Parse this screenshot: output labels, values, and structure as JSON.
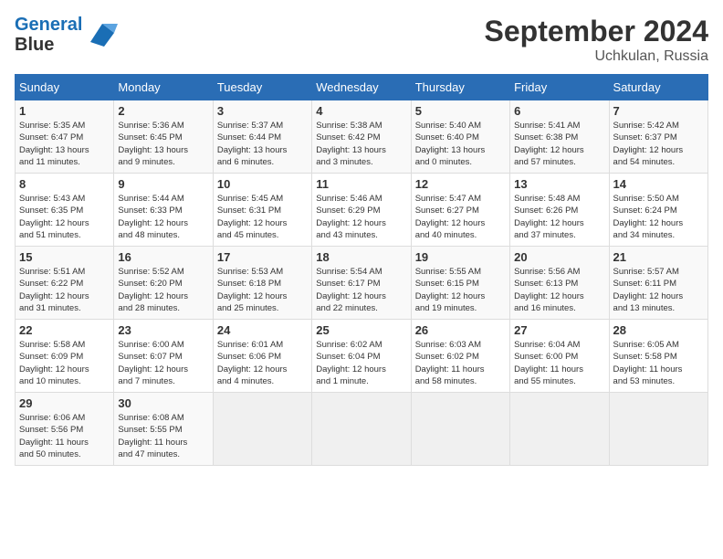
{
  "logo": {
    "line1": "General",
    "line2": "Blue"
  },
  "title": "September 2024",
  "location": "Uchkulan, Russia",
  "days_of_week": [
    "Sunday",
    "Monday",
    "Tuesday",
    "Wednesday",
    "Thursday",
    "Friday",
    "Saturday"
  ],
  "weeks": [
    [
      {
        "day": "1",
        "detail": "Sunrise: 5:35 AM\nSunset: 6:47 PM\nDaylight: 13 hours\nand 11 minutes."
      },
      {
        "day": "2",
        "detail": "Sunrise: 5:36 AM\nSunset: 6:45 PM\nDaylight: 13 hours\nand 9 minutes."
      },
      {
        "day": "3",
        "detail": "Sunrise: 5:37 AM\nSunset: 6:44 PM\nDaylight: 13 hours\nand 6 minutes."
      },
      {
        "day": "4",
        "detail": "Sunrise: 5:38 AM\nSunset: 6:42 PM\nDaylight: 13 hours\nand 3 minutes."
      },
      {
        "day": "5",
        "detail": "Sunrise: 5:40 AM\nSunset: 6:40 PM\nDaylight: 13 hours\nand 0 minutes."
      },
      {
        "day": "6",
        "detail": "Sunrise: 5:41 AM\nSunset: 6:38 PM\nDaylight: 12 hours\nand 57 minutes."
      },
      {
        "day": "7",
        "detail": "Sunrise: 5:42 AM\nSunset: 6:37 PM\nDaylight: 12 hours\nand 54 minutes."
      }
    ],
    [
      {
        "day": "8",
        "detail": "Sunrise: 5:43 AM\nSunset: 6:35 PM\nDaylight: 12 hours\nand 51 minutes."
      },
      {
        "day": "9",
        "detail": "Sunrise: 5:44 AM\nSunset: 6:33 PM\nDaylight: 12 hours\nand 48 minutes."
      },
      {
        "day": "10",
        "detail": "Sunrise: 5:45 AM\nSunset: 6:31 PM\nDaylight: 12 hours\nand 45 minutes."
      },
      {
        "day": "11",
        "detail": "Sunrise: 5:46 AM\nSunset: 6:29 PM\nDaylight: 12 hours\nand 43 minutes."
      },
      {
        "day": "12",
        "detail": "Sunrise: 5:47 AM\nSunset: 6:27 PM\nDaylight: 12 hours\nand 40 minutes."
      },
      {
        "day": "13",
        "detail": "Sunrise: 5:48 AM\nSunset: 6:26 PM\nDaylight: 12 hours\nand 37 minutes."
      },
      {
        "day": "14",
        "detail": "Sunrise: 5:50 AM\nSunset: 6:24 PM\nDaylight: 12 hours\nand 34 minutes."
      }
    ],
    [
      {
        "day": "15",
        "detail": "Sunrise: 5:51 AM\nSunset: 6:22 PM\nDaylight: 12 hours\nand 31 minutes."
      },
      {
        "day": "16",
        "detail": "Sunrise: 5:52 AM\nSunset: 6:20 PM\nDaylight: 12 hours\nand 28 minutes."
      },
      {
        "day": "17",
        "detail": "Sunrise: 5:53 AM\nSunset: 6:18 PM\nDaylight: 12 hours\nand 25 minutes."
      },
      {
        "day": "18",
        "detail": "Sunrise: 5:54 AM\nSunset: 6:17 PM\nDaylight: 12 hours\nand 22 minutes."
      },
      {
        "day": "19",
        "detail": "Sunrise: 5:55 AM\nSunset: 6:15 PM\nDaylight: 12 hours\nand 19 minutes."
      },
      {
        "day": "20",
        "detail": "Sunrise: 5:56 AM\nSunset: 6:13 PM\nDaylight: 12 hours\nand 16 minutes."
      },
      {
        "day": "21",
        "detail": "Sunrise: 5:57 AM\nSunset: 6:11 PM\nDaylight: 12 hours\nand 13 minutes."
      }
    ],
    [
      {
        "day": "22",
        "detail": "Sunrise: 5:58 AM\nSunset: 6:09 PM\nDaylight: 12 hours\nand 10 minutes."
      },
      {
        "day": "23",
        "detail": "Sunrise: 6:00 AM\nSunset: 6:07 PM\nDaylight: 12 hours\nand 7 minutes."
      },
      {
        "day": "24",
        "detail": "Sunrise: 6:01 AM\nSunset: 6:06 PM\nDaylight: 12 hours\nand 4 minutes."
      },
      {
        "day": "25",
        "detail": "Sunrise: 6:02 AM\nSunset: 6:04 PM\nDaylight: 12 hours\nand 1 minute."
      },
      {
        "day": "26",
        "detail": "Sunrise: 6:03 AM\nSunset: 6:02 PM\nDaylight: 11 hours\nand 58 minutes."
      },
      {
        "day": "27",
        "detail": "Sunrise: 6:04 AM\nSunset: 6:00 PM\nDaylight: 11 hours\nand 55 minutes."
      },
      {
        "day": "28",
        "detail": "Sunrise: 6:05 AM\nSunset: 5:58 PM\nDaylight: 11 hours\nand 53 minutes."
      }
    ],
    [
      {
        "day": "29",
        "detail": "Sunrise: 6:06 AM\nSunset: 5:56 PM\nDaylight: 11 hours\nand 50 minutes."
      },
      {
        "day": "30",
        "detail": "Sunrise: 6:08 AM\nSunset: 5:55 PM\nDaylight: 11 hours\nand 47 minutes."
      },
      {
        "day": "",
        "detail": ""
      },
      {
        "day": "",
        "detail": ""
      },
      {
        "day": "",
        "detail": ""
      },
      {
        "day": "",
        "detail": ""
      },
      {
        "day": "",
        "detail": ""
      }
    ]
  ]
}
